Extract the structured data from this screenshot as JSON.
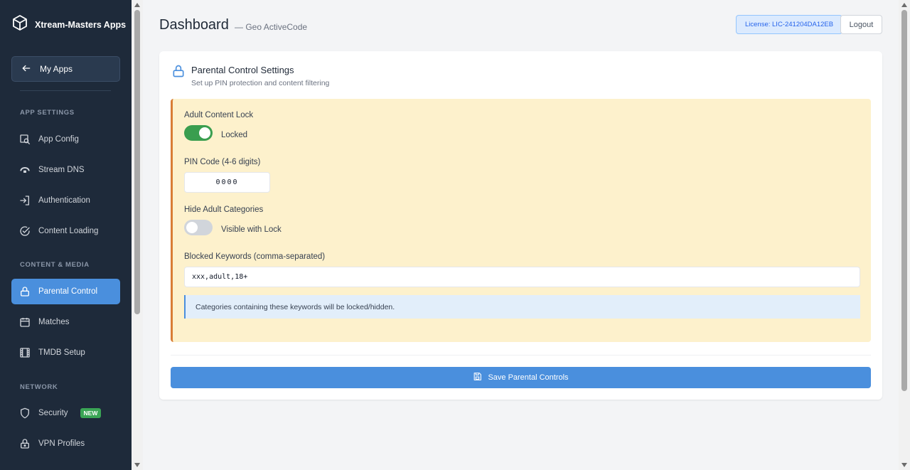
{
  "brand": {
    "name": "Xtream-Masters Apps"
  },
  "sidebar": {
    "back_label": "My Apps",
    "sections": {
      "app_settings": "APP SETTINGS",
      "content_media": "CONTENT & MEDIA",
      "network": "NETWORK"
    },
    "items": [
      {
        "label": "App Config",
        "icon": "search-window-icon"
      },
      {
        "label": "Stream DNS",
        "icon": "cloud-icon"
      },
      {
        "label": "Authentication",
        "icon": "sign-in-icon"
      },
      {
        "label": "Content Loading",
        "icon": "check-circle-icon"
      },
      {
        "label": "Parental Control",
        "icon": "lock-icon",
        "active": true
      },
      {
        "label": "Matches",
        "icon": "calendar-icon"
      },
      {
        "label": "TMDB Setup",
        "icon": "film-icon"
      },
      {
        "label": "Security",
        "icon": "shield-icon",
        "badge": "NEW"
      },
      {
        "label": "VPN Profiles",
        "icon": "lock-icon"
      }
    ]
  },
  "header": {
    "title": "Dashboard",
    "subtitle": "— Geo ActiveCode",
    "license": "License: LIC-241204DA12EB",
    "logout": "Logout"
  },
  "card": {
    "title": "Parental Control Settings",
    "description": "Set up PIN protection and content filtering",
    "adult_lock": {
      "label": "Adult Content Lock",
      "status": "Locked",
      "on": true
    },
    "pin": {
      "label": "PIN Code (4-6 digits)",
      "value": "0000"
    },
    "hide_adult": {
      "label": "Hide Adult Categories",
      "status": "Visible with Lock",
      "on": false
    },
    "keywords": {
      "label": "Blocked Keywords (comma-separated)",
      "value": "xxx,adult,18+"
    },
    "info": "Categories containing these keywords will be locked/hidden.",
    "save_label": "Save Parental Controls"
  },
  "colors": {
    "sidebar_bg": "#1e2a3a",
    "accent": "#4a8fdd",
    "toggle_on": "#3a9e4f",
    "panel_bg": "#fdf1cc",
    "panel_border": "#d97d35",
    "badge_new": "#3aa555"
  }
}
